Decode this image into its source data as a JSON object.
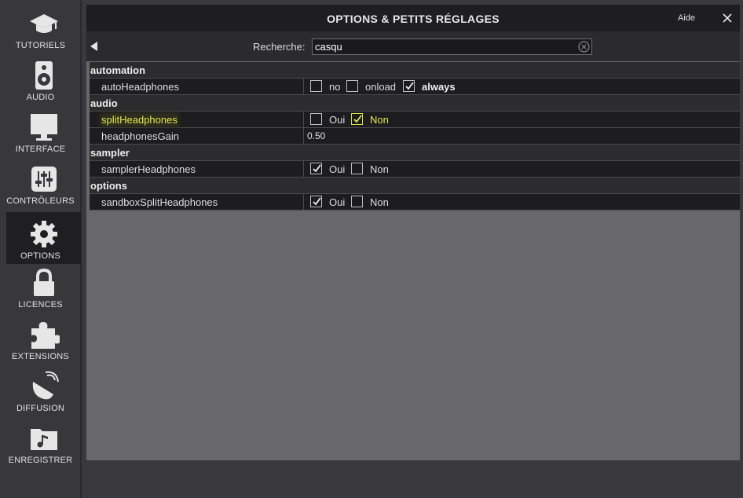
{
  "sidebar": {
    "items": [
      {
        "label": "TUTORIELS",
        "icon": "graduation-cap-icon",
        "active": false
      },
      {
        "label": "AUDIO",
        "icon": "speaker-icon",
        "active": false
      },
      {
        "label": "INTERFACE",
        "icon": "monitor-icon",
        "active": false
      },
      {
        "label": "CONTRÔLEURS",
        "icon": "sliders-icon",
        "active": false
      },
      {
        "label": "OPTIONS",
        "icon": "gear-icon",
        "active": true
      },
      {
        "label": "LICENCES",
        "icon": "lock-icon",
        "active": false
      },
      {
        "label": "EXTENSIONS",
        "icon": "puzzle-icon",
        "active": false
      },
      {
        "label": "DIFFUSION",
        "icon": "satellite-dish-icon",
        "active": false
      },
      {
        "label": "ENREGISTRER",
        "icon": "music-folder-icon",
        "active": false
      }
    ]
  },
  "header": {
    "title": "OPTIONS & PETITS RÉGLAGES",
    "help_label": "Aide"
  },
  "search": {
    "label": "Recherche:",
    "value": "casqu"
  },
  "sections": {
    "automation": {
      "title": "automation",
      "autoHeadphones": {
        "name": "autoHeadphones",
        "options": [
          "no",
          "onload",
          "always"
        ],
        "checked": "always"
      }
    },
    "audio": {
      "title": "audio",
      "splitHeadphones": {
        "name": "splitHeadphones",
        "options": [
          "Oui",
          "Non"
        ],
        "checked": "Non",
        "highlighted": true
      },
      "headphonesGain": {
        "name": "headphonesGain",
        "value": "0.50"
      }
    },
    "sampler": {
      "title": "sampler",
      "samplerHeadphones": {
        "name": "samplerHeadphones",
        "options": [
          "Oui",
          "Non"
        ],
        "checked": "Oui"
      }
    },
    "options": {
      "title": "options",
      "sandboxSplitHeadphones": {
        "name": "sandboxSplitHeadphones",
        "options": [
          "Oui",
          "Non"
        ],
        "checked": "Oui"
      }
    }
  },
  "colors": {
    "highlight": "#e2e84a",
    "panel": "#67676c",
    "titlebar": "#1e1e21"
  }
}
